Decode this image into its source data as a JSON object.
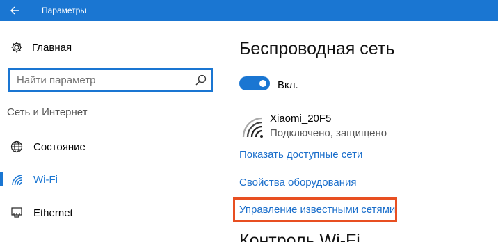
{
  "window": {
    "title": "Параметры"
  },
  "sidebar": {
    "home_label": "Главная",
    "search_placeholder": "Найти параметр",
    "section_heading": "Сеть и Интернет",
    "items": [
      {
        "label": "Состояние",
        "icon": "globe-icon",
        "active": false
      },
      {
        "label": "Wi-Fi",
        "icon": "wifi-icon",
        "active": true
      },
      {
        "label": "Ethernet",
        "icon": "ethernet-icon",
        "active": false
      }
    ]
  },
  "main": {
    "title": "Беспроводная сеть",
    "toggle_label": "Вкл.",
    "toggle_on": true,
    "network": {
      "ssid": "Xiaomi_20F5",
      "status": "Подключено, защищено"
    },
    "links": {
      "show_available": "Показать доступные сети",
      "hardware_properties": "Свойства оборудования",
      "manage_known": "Управление известными сетями"
    },
    "next_heading": "Контроль Wi-Fi"
  },
  "colors": {
    "accent": "#1a76d2",
    "highlight": "#e84f21"
  }
}
